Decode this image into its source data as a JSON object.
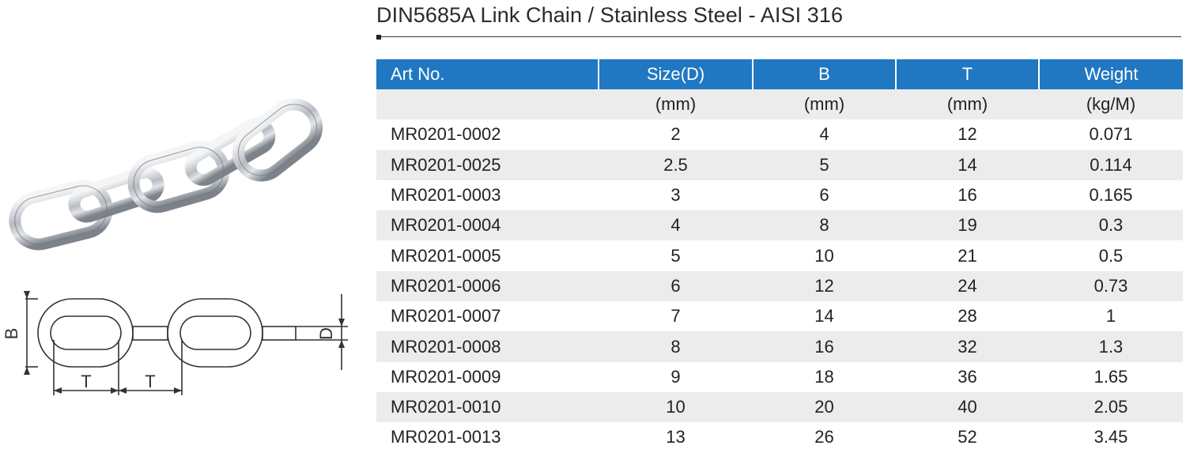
{
  "title": "DIN5685A Link Chain / Stainless Steel - AISI 316",
  "diagram": {
    "label_b": "B",
    "label_d": "D",
    "label_t1": "T",
    "label_t2": "T"
  },
  "table": {
    "headers": [
      "Art No.",
      "Size(D)",
      "B",
      "T",
      "Weight"
    ],
    "units": [
      "",
      "(mm)",
      "(mm)",
      "(mm)",
      "(kg/M)"
    ],
    "rows": [
      [
        "MR0201-0002",
        "2",
        "4",
        "12",
        "0.071"
      ],
      [
        "MR0201-0025",
        "2.5",
        "5",
        "14",
        "0.114"
      ],
      [
        "MR0201-0003",
        "3",
        "6",
        "16",
        "0.165"
      ],
      [
        "MR0201-0004",
        "4",
        "8",
        "19",
        "0.3"
      ],
      [
        "MR0201-0005",
        "5",
        "10",
        "21",
        "0.5"
      ],
      [
        "MR0201-0006",
        "6",
        "12",
        "24",
        "0.73"
      ],
      [
        "MR0201-0007",
        "7",
        "14",
        "28",
        "1"
      ],
      [
        "MR0201-0008",
        "8",
        "16",
        "32",
        "1.3"
      ],
      [
        "MR0201-0009",
        "9",
        "18",
        "36",
        "1.65"
      ],
      [
        "MR0201-0010",
        "10",
        "20",
        "40",
        "2.05"
      ],
      [
        "MR0201-0013",
        "13",
        "26",
        "52",
        "3.45"
      ]
    ]
  },
  "colors": {
    "header_bg": "#1f78c1",
    "stripe": "#ececec",
    "steel": "#b9bec4"
  }
}
